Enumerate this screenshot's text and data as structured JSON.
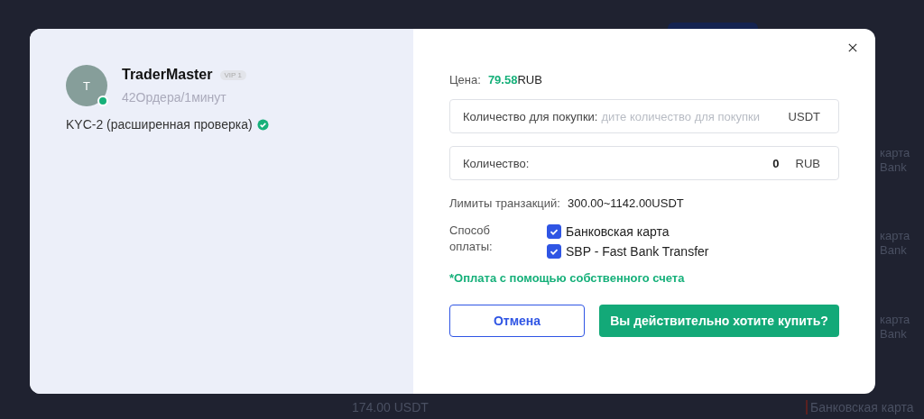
{
  "backdrop": {
    "side_texts": [
      "карта",
      "Bank",
      "карта",
      "Bank",
      "карта",
      "Bank"
    ],
    "bottom_texts": [
      "174.00 USDT",
      "Банковская карта"
    ]
  },
  "seller": {
    "avatar_letter": "T",
    "online": true,
    "name": "TraderMaster",
    "vip": "VIP 1",
    "stats": "42Ордера/1минут",
    "kyc": "KYC-2 (расширенная проверка)",
    "kyc_verified": true
  },
  "price": {
    "label": "Цена:",
    "value": "79.58",
    "currency": "RUB"
  },
  "fields": [
    {
      "label": "Количество для покупки:",
      "placeholder": "дите количество для покупки",
      "unit": "USDT"
    },
    {
      "label": "Количество:",
      "value": "0",
      "unit": "RUB"
    }
  ],
  "limits": {
    "label": "Лимиты транзакций:",
    "value": "300.00~1142.00USDT"
  },
  "payment": {
    "label": "Способ оплаты:",
    "methods": [
      {
        "name": "Банковская карта",
        "checked": true
      },
      {
        "name": "SBP - Fast Bank Transfer",
        "checked": true
      }
    ]
  },
  "note": "*Оплата с помощью собственного счета",
  "buttons": [
    {
      "label": "Отмена",
      "kind": "secondary"
    },
    {
      "label": "Вы действительно хотите купить?",
      "kind": "primary"
    }
  ]
}
